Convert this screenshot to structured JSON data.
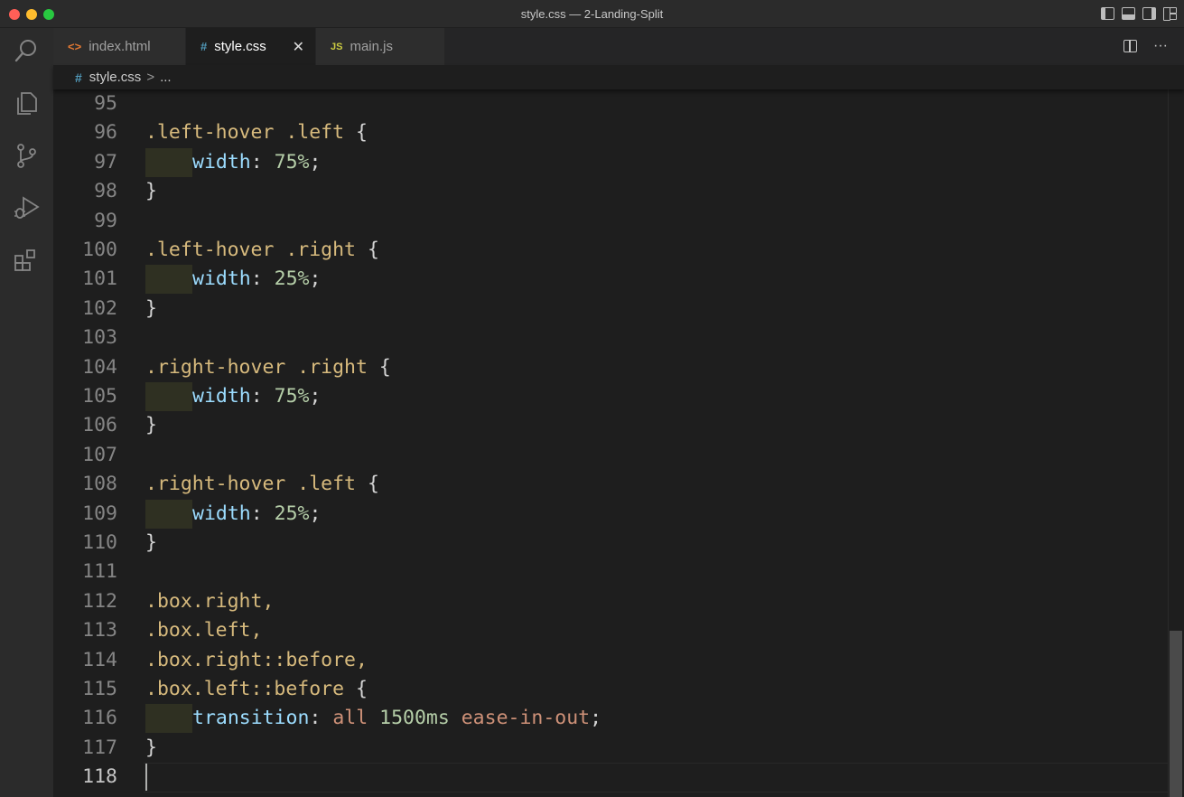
{
  "window": {
    "title": "style.css — 2-Landing-Split"
  },
  "tabs": [
    {
      "label": "index.html",
      "icon": "<>",
      "icon_color": "#e37933",
      "active": false
    },
    {
      "label": "style.css",
      "icon": "#",
      "icon_color": "#519aba",
      "active": true,
      "close": "✕"
    },
    {
      "label": "main.js",
      "icon": "JS",
      "icon_color": "#cbcb41",
      "active": false
    }
  ],
  "tab_actions": {
    "more": "···"
  },
  "breadcrumb": {
    "icon": "#",
    "file": "style.css",
    "separator": ">",
    "rest": "..."
  },
  "editor": {
    "lines": [
      {
        "n": "95",
        "segments": []
      },
      {
        "n": "96",
        "segments": [
          {
            "t": ".left-hover .left ",
            "c": "sel"
          },
          {
            "t": "{",
            "c": "brace"
          }
        ]
      },
      {
        "n": "97",
        "indent": true,
        "segments": [
          {
            "t": "width",
            "c": "prop"
          },
          {
            "t": ": ",
            "c": "punc"
          },
          {
            "t": "75%",
            "c": "num"
          },
          {
            "t": ";",
            "c": "punc"
          }
        ]
      },
      {
        "n": "98",
        "segments": [
          {
            "t": "}",
            "c": "brace"
          }
        ]
      },
      {
        "n": "99",
        "segments": []
      },
      {
        "n": "100",
        "segments": [
          {
            "t": ".left-hover .right ",
            "c": "sel"
          },
          {
            "t": "{",
            "c": "brace"
          }
        ]
      },
      {
        "n": "101",
        "indent": true,
        "segments": [
          {
            "t": "width",
            "c": "prop"
          },
          {
            "t": ": ",
            "c": "punc"
          },
          {
            "t": "25%",
            "c": "num"
          },
          {
            "t": ";",
            "c": "punc"
          }
        ]
      },
      {
        "n": "102",
        "segments": [
          {
            "t": "}",
            "c": "brace"
          }
        ]
      },
      {
        "n": "103",
        "segments": []
      },
      {
        "n": "104",
        "segments": [
          {
            "t": ".right-hover .right ",
            "c": "sel"
          },
          {
            "t": "{",
            "c": "brace"
          }
        ]
      },
      {
        "n": "105",
        "indent": true,
        "segments": [
          {
            "t": "width",
            "c": "prop"
          },
          {
            "t": ": ",
            "c": "punc"
          },
          {
            "t": "75%",
            "c": "num"
          },
          {
            "t": ";",
            "c": "punc"
          }
        ]
      },
      {
        "n": "106",
        "segments": [
          {
            "t": "}",
            "c": "brace"
          }
        ]
      },
      {
        "n": "107",
        "segments": []
      },
      {
        "n": "108",
        "segments": [
          {
            "t": ".right-hover .left ",
            "c": "sel"
          },
          {
            "t": "{",
            "c": "brace"
          }
        ]
      },
      {
        "n": "109",
        "indent": true,
        "segments": [
          {
            "t": "width",
            "c": "prop"
          },
          {
            "t": ": ",
            "c": "punc"
          },
          {
            "t": "25%",
            "c": "num"
          },
          {
            "t": ";",
            "c": "punc"
          }
        ]
      },
      {
        "n": "110",
        "segments": [
          {
            "t": "}",
            "c": "brace"
          }
        ]
      },
      {
        "n": "111",
        "segments": []
      },
      {
        "n": "112",
        "segments": [
          {
            "t": ".box.right,",
            "c": "sel"
          }
        ]
      },
      {
        "n": "113",
        "segments": [
          {
            "t": ".box.left,",
            "c": "sel"
          }
        ]
      },
      {
        "n": "114",
        "segments": [
          {
            "t": ".box.right::before,",
            "c": "sel"
          }
        ]
      },
      {
        "n": "115",
        "segments": [
          {
            "t": ".box.left::before ",
            "c": "sel"
          },
          {
            "t": "{",
            "c": "brace"
          }
        ]
      },
      {
        "n": "116",
        "indent": true,
        "segments": [
          {
            "t": "transition",
            "c": "prop"
          },
          {
            "t": ": ",
            "c": "punc"
          },
          {
            "t": "all ",
            "c": "kw"
          },
          {
            "t": "1500ms ",
            "c": "num"
          },
          {
            "t": "ease-in-out",
            "c": "kw"
          },
          {
            "t": ";",
            "c": "punc"
          }
        ]
      },
      {
        "n": "117",
        "segments": [
          {
            "t": "}",
            "c": "brace"
          }
        ]
      },
      {
        "n": "118",
        "current": true,
        "segments": []
      }
    ]
  },
  "colors": {
    "selector": "#d7ba7d",
    "property": "#9cdcfe",
    "number": "#b5cea8",
    "keyword": "#ce9178",
    "background": "#1e1e1e"
  }
}
